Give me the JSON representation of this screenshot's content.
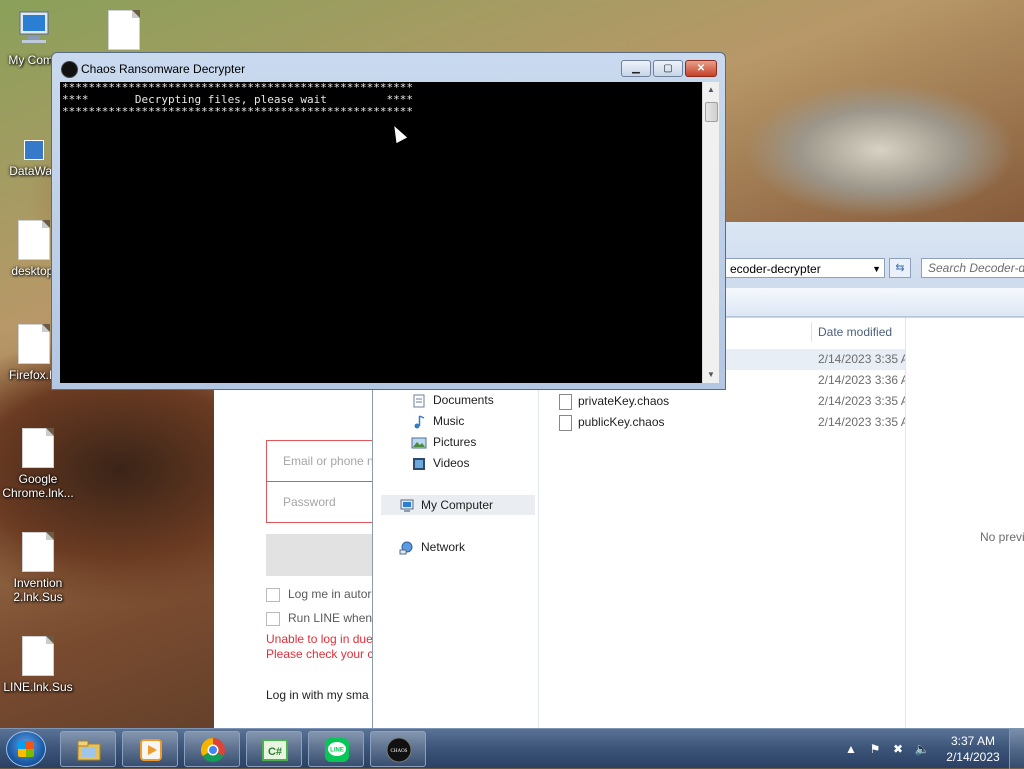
{
  "desktop": {
    "icons": [
      {
        "label": "My Comp"
      },
      {
        "label": "DataWag"
      },
      {
        "label": "desktop."
      },
      {
        "label": "Firefox.In"
      },
      {
        "label": "Google Chrome.lnk..."
      },
      {
        "label": "Invention 2.lnk.Sus"
      },
      {
        "label": "LINE.lnk.Sus"
      }
    ]
  },
  "console": {
    "title": "Chaos Ransomware Decrypter",
    "lines": [
      "*****************************************************",
      "****       Decrypting files, please wait         ****",
      "*****************************************************"
    ],
    "buttons": {
      "minimize": "▁",
      "maximize": "▢",
      "close": "✕"
    }
  },
  "explorer": {
    "address": "ecoder-decrypter",
    "search_placeholder": "Search Decoder-de",
    "nav": [
      {
        "label": "Documents",
        "icon": "documents-icon"
      },
      {
        "label": "Music",
        "icon": "music-icon"
      },
      {
        "label": "Pictures",
        "icon": "pictures-icon"
      },
      {
        "label": "Videos",
        "icon": "videos-icon"
      },
      {
        "label": "My Computer",
        "icon": "computer-icon"
      },
      {
        "label": "Network",
        "icon": "network-icon"
      }
    ],
    "columns": {
      "date_modified": "Date modified"
    },
    "files": [
      {
        "name": "",
        "date": "2/14/2023 3:35 A"
      },
      {
        "name": "",
        "date": "2/14/2023 3:36 A"
      },
      {
        "name": "privateKey.chaos",
        "date": "2/14/2023 3:35 A"
      },
      {
        "name": "publicKey.chaos",
        "date": "2/14/2023 3:35 A"
      }
    ],
    "preview": "No previ"
  },
  "line_login": {
    "email_placeholder": "Email or phone n",
    "password_placeholder": "Password",
    "auto_login": "Log me in autor",
    "run_line": "Run LINE when",
    "error_line1": "Unable to log in due",
    "error_line2": "Please check your co",
    "smartphone_link": "Log in with my sma",
    "error_color": "#e0303a"
  },
  "taskbar": {
    "clock_time": "3:37 AM",
    "clock_date": "2/14/2023",
    "pinned": [
      {
        "name": "explorer-icon",
        "color": "#e8c25a"
      },
      {
        "name": "media-player-icon",
        "color": "#f09a2a"
      },
      {
        "name": "chrome-icon",
        "color": "#db4437"
      },
      {
        "name": "csharp-icon",
        "color": "#4caf50"
      },
      {
        "name": "line-icon",
        "color": "#06c755"
      },
      {
        "name": "chaos-icon",
        "color": "#111111"
      }
    ],
    "csharp_label": "C#",
    "line_label": "LINE",
    "chaos_label": "CHAOS"
  }
}
